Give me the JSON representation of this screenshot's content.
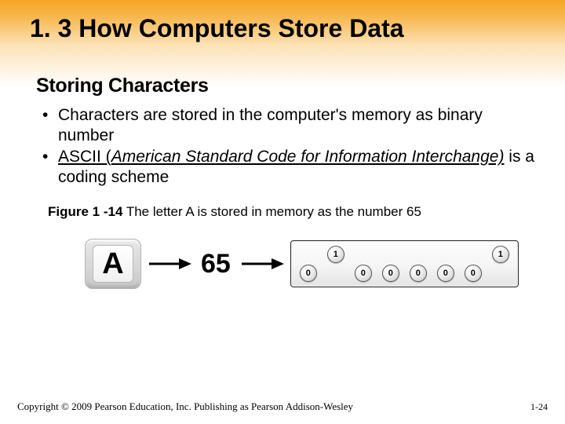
{
  "title": "1. 3 How Computers Store Data",
  "subtitle": "Storing Characters",
  "bullets": [
    {
      "pre": "Characters are stored in the computer's memory as binary number"
    },
    {
      "u": "ASCII (",
      "em": "American Standard Code for Information Interchange)",
      "post": " is a coding scheme"
    }
  ],
  "figure": {
    "num": "Figure 1 -14",
    "desc": "  The letter A is stored in memory as the number 65",
    "letter": "A",
    "code": "65",
    "bits": [
      {
        "v": "0",
        "on": false
      },
      {
        "v": "1",
        "on": true
      },
      {
        "v": "0",
        "on": false
      },
      {
        "v": "0",
        "on": false
      },
      {
        "v": "0",
        "on": false
      },
      {
        "v": "0",
        "on": false
      },
      {
        "v": "0",
        "on": false
      },
      {
        "v": "1",
        "on": true
      }
    ]
  },
  "footer": {
    "copyright": "Copyright © 2009 Pearson Education, Inc. Publishing as Pearson Addison-Wesley",
    "page": "1-24"
  }
}
